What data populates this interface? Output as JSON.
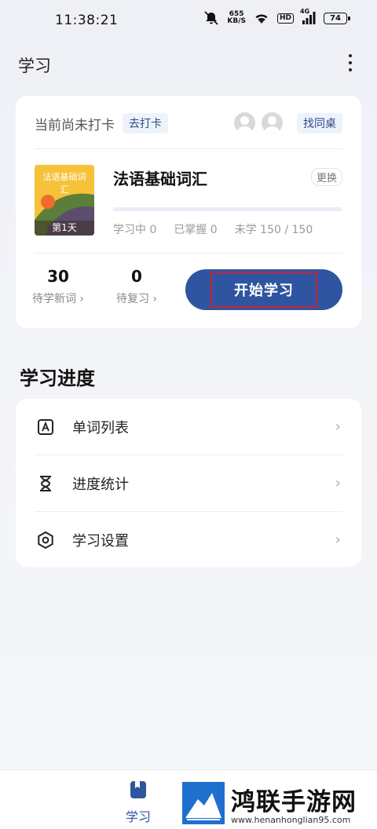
{
  "status_bar": {
    "time": "11:38:21",
    "net_speed_value": "655",
    "net_speed_unit": "KB/S",
    "hd_label": "HD",
    "signal_label": "4G",
    "battery": "74"
  },
  "header": {
    "title": "学习",
    "more_icon": "more-vertical-icon"
  },
  "checkin": {
    "status": "当前尚未打卡",
    "checkin_button": "去打卡",
    "find_deskmate_button": "找同桌"
  },
  "book": {
    "cover_title": "法语基础词汇",
    "cover_day": "第1天",
    "name": "法语基础词汇",
    "change_button": "更换",
    "progress_fraction": 0,
    "stats": {
      "learning": "学习中 0",
      "mastered": "已掌握 0",
      "unlearned": "未学 150 / 150"
    }
  },
  "counts": {
    "new_words": {
      "value": "30",
      "label": "待学新词 ›"
    },
    "review": {
      "value": "0",
      "label": "待复习 ›"
    }
  },
  "start_button": "开始学习",
  "progress_section": {
    "title": "学习进度",
    "items": [
      {
        "label": "单词列表",
        "icon": "word-list-icon",
        "chevron": "›"
      },
      {
        "label": "进度统计",
        "icon": "hourglass-icon",
        "chevron": "›"
      },
      {
        "label": "学习设置",
        "icon": "hexagon-settings-icon",
        "chevron": "›"
      }
    ]
  },
  "bottom_nav": {
    "tabs": [
      {
        "label": "学习",
        "icon": "book-icon",
        "active": true
      }
    ]
  },
  "watermark": {
    "name": "鸿联手游网",
    "url": "www.henanhonglian95.com"
  },
  "colors": {
    "accent": "#2f55a0",
    "highlight_border": "#c8223a",
    "cover_yellow": "#f5c23a"
  }
}
